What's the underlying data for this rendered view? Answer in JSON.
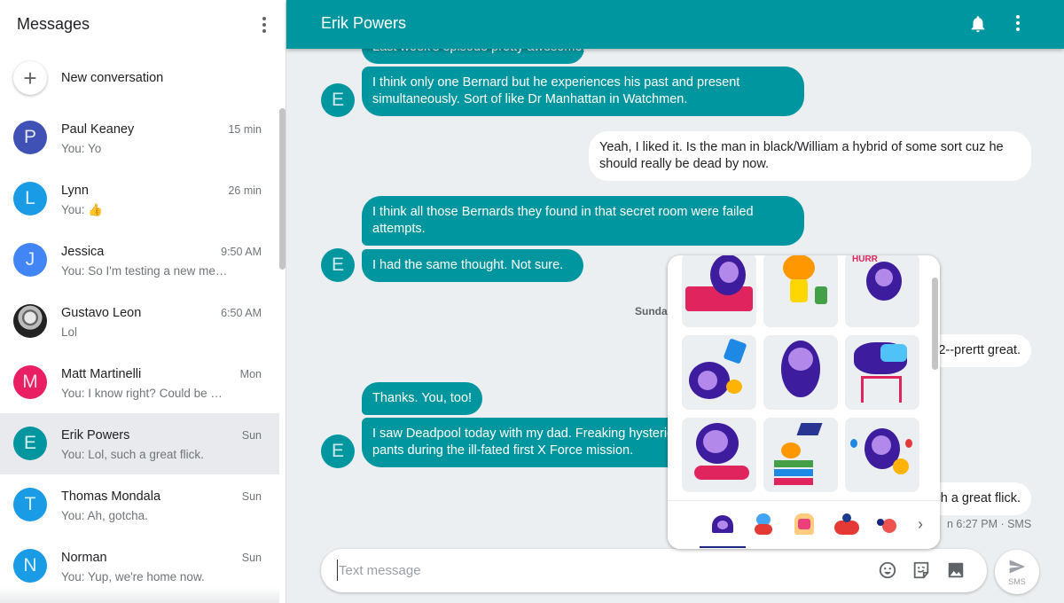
{
  "sidebar": {
    "title": "Messages",
    "new_conversation_label": "New conversation",
    "conversations": [
      {
        "name": "Paul Keaney",
        "initial": "P",
        "time": "15 min",
        "snippet": "You: Yo",
        "color": "#3f51b5"
      },
      {
        "name": "Lynn",
        "initial": "L",
        "time": "26 min",
        "snippet": "You: 👍",
        "color": "#1a9be6"
      },
      {
        "name": "Jessica",
        "initial": "J",
        "time": "9:50 AM",
        "snippet": "You: So I'm testing a new me…",
        "color": "#4285f4"
      },
      {
        "name": "Gustavo Leon",
        "initial": "",
        "time": "6:50 AM",
        "snippet": "Lol",
        "color": "#222222"
      },
      {
        "name": "Matt Martinelli",
        "initial": "M",
        "time": "Mon",
        "snippet": "You: I know right? Could be …",
        "color": "#e91e63"
      },
      {
        "name": "Erik Powers",
        "initial": "E",
        "time": "Sun",
        "snippet": "You: Lol, such a great flick.",
        "color": "#00969f",
        "active": true
      },
      {
        "name": "Thomas Mondala",
        "initial": "T",
        "time": "Sun",
        "snippet": "You: Ah, gotcha.",
        "color": "#1a9be6"
      },
      {
        "name": "Norman",
        "initial": "N",
        "time": "Sun",
        "snippet": "You: Yup, we're home now.",
        "color": "#1a9be6"
      }
    ]
  },
  "header": {
    "title": "Erik Powers",
    "accent": "#00969f"
  },
  "thread": {
    "contact_initial": "E",
    "messages": [
      {
        "dir": "in",
        "text": "Last week's episode pretty awesome."
      },
      {
        "dir": "in",
        "text": "I think only one Bernard but he experiences his past and present simultaneously.   Sort of like Dr Manhattan in Watchmen."
      },
      {
        "dir": "out",
        "text": "Yeah, I liked it. Is the man in black/William a hybrid of some sort cuz he should really be dead by now."
      },
      {
        "dir": "in",
        "text": "I think all those Bernards they found in that secret room were failed attempts."
      },
      {
        "dir": "in",
        "text": "I had the same thought.   Not sure."
      },
      {
        "dir": "date",
        "text": "Sunday"
      },
      {
        "dir": "out",
        "text": "2--prertt great."
      },
      {
        "dir": "in",
        "text": "Thanks.  You, too!"
      },
      {
        "dir": "in",
        "text": "I saw Deadpool today with my dad.  Freaking hysterical…"
      },
      {
        "dir": "in",
        "text": "pants during the ill-fated first X Force mission."
      },
      {
        "dir": "out",
        "text": "ch a great flick."
      }
    ],
    "date_separator": "Sunda",
    "last_meta": "n 6:27 PM · SMS"
  },
  "compose": {
    "placeholder": "Text message",
    "value": "",
    "send_label": "SMS"
  },
  "sticker_panel": {
    "stickers": [
      "monster-on-couch",
      "monkey-with-luggage",
      "monster-hurray",
      "monster-eating-chips",
      "monster-surprised",
      "monster-bunk-bed",
      "monster-driving-car",
      "monkey-reading-lamp",
      "monster-party"
    ],
    "packs": [
      "monster-pack",
      "blue-bird-pack",
      "toast-pack",
      "crab-pack",
      "bomb-pack"
    ],
    "active_pack": 0
  }
}
